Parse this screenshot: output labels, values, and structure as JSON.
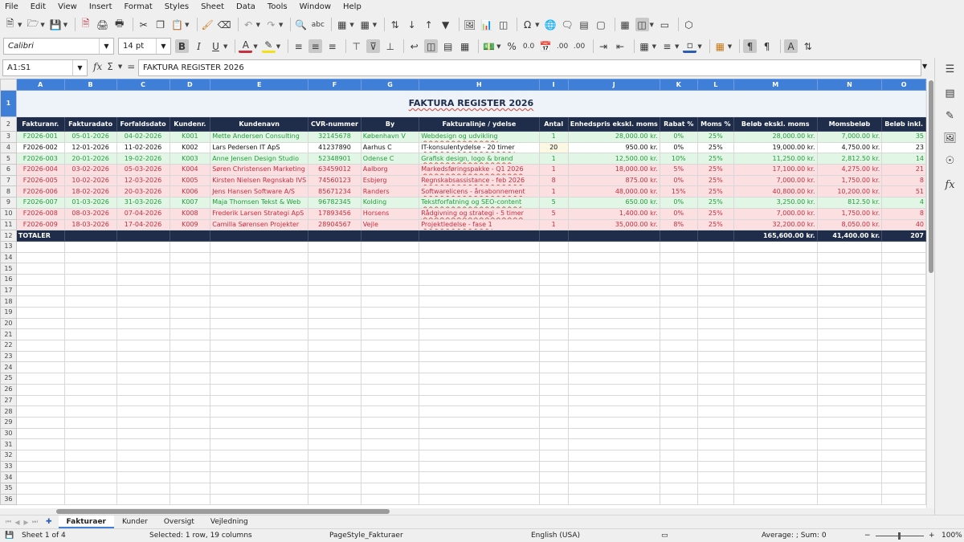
{
  "menu": [
    "File",
    "Edit",
    "View",
    "Insert",
    "Format",
    "Styles",
    "Sheet",
    "Data",
    "Tools",
    "Window",
    "Help"
  ],
  "toolbar": {
    "font_name": "Calibri",
    "font_size": "14 pt",
    "percent": "%",
    "number_format": "0.0",
    "decimals_add": ".00",
    "decimals_remove": ".00"
  },
  "formula": {
    "cell_ref": "A1:S1",
    "content": "FAKTURA REGISTER 2026"
  },
  "column_letters": [
    "A",
    "B",
    "C",
    "D",
    "E",
    "F",
    "G",
    "H",
    "I",
    "J",
    "K",
    "L",
    "M",
    "N",
    "O"
  ],
  "title": "FAKTURA REGISTER 2026",
  "headers": [
    "Fakturanr.",
    "Fakturadato",
    "Forfaldsdato",
    "Kundenr.",
    "Kundenavn",
    "CVR-nummer",
    "By",
    "Fakturalinje / ydelse",
    "Antal",
    "Enhedspris ekskl. moms",
    "Rabat %",
    "Moms %",
    "Beløb ekskl. moms",
    "Momsbeløb",
    "Beløb inkl."
  ],
  "rows": [
    {
      "status": "g",
      "cells": [
        "F2026-001",
        "05-01-2026",
        "04-02-2026",
        "K001",
        "Mette Andersen Consulting",
        "32145678",
        "København V",
        "Webdesign og udvikling",
        "1",
        "28,000.00 kr.",
        "0%",
        "25%",
        "28,000.00 kr.",
        "7,000.00 kr.",
        "35"
      ]
    },
    {
      "status": "w",
      "cells": [
        "F2026-002",
        "12-01-2026",
        "11-02-2026",
        "K002",
        "Lars Pedersen IT ApS",
        "41237890",
        "Aarhus C",
        "IT-konsulentydelse - 20 timer",
        "20",
        "950.00 kr.",
        "0%",
        "25%",
        "19,000.00 kr.",
        "4,750.00 kr.",
        "23"
      ]
    },
    {
      "status": "g",
      "cells": [
        "F2026-003",
        "20-01-2026",
        "19-02-2026",
        "K003",
        "Anne Jensen Design Studio",
        "52348901",
        "Odense C",
        "Grafisk design, logo & brand",
        "1",
        "12,500.00 kr.",
        "10%",
        "25%",
        "11,250.00 kr.",
        "2,812.50 kr.",
        "14"
      ]
    },
    {
      "status": "r",
      "cells": [
        "F2026-004",
        "03-02-2026",
        "05-03-2026",
        "K004",
        "Søren Christensen Marketing",
        "63459012",
        "Aalborg",
        "Markedsføringspakke - Q1 2026",
        "1",
        "18,000.00 kr.",
        "5%",
        "25%",
        "17,100.00 kr.",
        "4,275.00 kr.",
        "21"
      ]
    },
    {
      "status": "r",
      "cells": [
        "F2026-005",
        "10-02-2026",
        "12-03-2026",
        "K005",
        "Kirsten Nielsen Regnskab IVS",
        "74560123",
        "Esbjerg",
        "Regnskabsassistance - feb 2026",
        "8",
        "875.00 kr.",
        "0%",
        "25%",
        "7,000.00 kr.",
        "1,750.00 kr.",
        "8"
      ]
    },
    {
      "status": "r",
      "cells": [
        "F2026-006",
        "18-02-2026",
        "20-03-2026",
        "K006",
        "Jens Hansen Software A/S",
        "85671234",
        "Randers",
        "Softwarelicens - årsabonnement",
        "1",
        "48,000.00 kr.",
        "15%",
        "25%",
        "40,800.00 kr.",
        "10,200.00 kr.",
        "51"
      ]
    },
    {
      "status": "g",
      "cells": [
        "F2026-007",
        "01-03-2026",
        "31-03-2026",
        "K007",
        "Maja Thomsen Tekst & Web",
        "96782345",
        "Kolding",
        "Tekstforfatning og SEO-content",
        "5",
        "650.00 kr.",
        "0%",
        "25%",
        "3,250.00 kr.",
        "812.50 kr.",
        "4"
      ]
    },
    {
      "status": "r",
      "cells": [
        "F2026-008",
        "08-03-2026",
        "07-04-2026",
        "K008",
        "Frederik Larsen Strategi ApS",
        "17893456",
        "Horsens",
        "Rådgivning og strategi - 5 timer",
        "5",
        "1,400.00 kr.",
        "0%",
        "25%",
        "7,000.00 kr.",
        "1,750.00 kr.",
        "8"
      ]
    },
    {
      "status": "r",
      "cells": [
        "F2026-009",
        "18-03-2026",
        "17-04-2026",
        "K009",
        "Camilla Sørensen Projekter",
        "28904567",
        "Vejle",
        "Projektledelse - fase 1",
        "1",
        "35,000.00 kr.",
        "8%",
        "25%",
        "32,200.00 kr.",
        "8,050.00 kr.",
        "40"
      ]
    }
  ],
  "totals": {
    "label": "TOTALER",
    "excl": "165,600.00 kr.",
    "moms": "41,400.00 kr.",
    "incl": "207"
  },
  "row_numbers": [
    "1",
    "2",
    "3",
    "4",
    "5",
    "6",
    "7",
    "8",
    "9",
    "10",
    "11",
    "12",
    "13",
    "14",
    "15",
    "16",
    "17",
    "18",
    "19",
    "20",
    "21",
    "22",
    "23",
    "24",
    "25",
    "26",
    "27",
    "28",
    "29",
    "30",
    "31",
    "32",
    "33",
    "34",
    "35",
    "36"
  ],
  "sheet_tabs": [
    "Fakturaer",
    "Kunder",
    "Oversigt",
    "Vejledning"
  ],
  "active_tab": 0,
  "status_bar": {
    "sheet": "Sheet 1 of 4",
    "selection": "Selected: 1 row, 19 columns",
    "page_style": "PageStyle_Fakturaer",
    "language": "English (USA)",
    "summary": "Average: ; Sum: 0",
    "zoom": "100%"
  },
  "colors": {
    "accent": "#3f7fd8",
    "header_navy": "#1f2d4a",
    "paid_green": "#269b3d",
    "overdue_red": "#c6303f"
  }
}
